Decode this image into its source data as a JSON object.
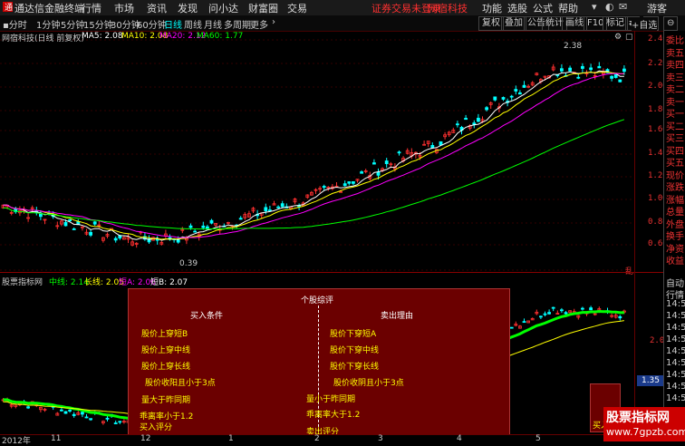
{
  "app": {
    "name": "通达信金融终端",
    "menu": [
      "行情",
      "市场",
      "资讯",
      "发现",
      "问小达",
      "财富圈",
      "交易"
    ],
    "notice": "证券交易未登录",
    "stock_name_top": "网宿科技",
    "right_menu": [
      "功能",
      "选股",
      "公式",
      "帮助"
    ],
    "guest": "游客"
  },
  "periods": [
    "分时",
    "1分钟",
    "5分钟",
    "15分钟",
    "30分钟",
    "60分钟",
    "日线",
    "周线",
    "月线",
    "多周期",
    "更多"
  ],
  "active_period": "日线",
  "toolbar_right": [
    "复权",
    "叠加",
    "公告",
    "统计",
    "画线",
    "F10",
    "标记"
  ],
  "main_chart": {
    "title": "网宿科技(日线 前复权)",
    "ma": [
      {
        "label": "MA5: 2.08",
        "color": "#ffffff"
      },
      {
        "label": "MA10: 2.08",
        "color": "#ffff00"
      },
      {
        "label": "MA20: 2.12",
        "color": "#ff00ff"
      },
      {
        "label": "MA60: 1.77",
        "color": "#00ff00"
      }
    ],
    "yticks": [
      "2.40",
      "2.20",
      "2.00",
      "1.80",
      "1.60",
      "1.40",
      "1.20",
      "1.00",
      "0.80",
      "0.60"
    ],
    "high_label": "2.38",
    "low_label": "0.39",
    "unit_mark": "乱"
  },
  "sub_chart": {
    "title": "股票指标网",
    "legend": [
      {
        "label": "中线: 2.14",
        "color": "#00ff00"
      },
      {
        "label": "长线: 2.05",
        "color": "#ffff00"
      },
      {
        "label": "短A: 2.06",
        "color": "#ff00ff"
      },
      {
        "label": "短B: 2.07",
        "color": "#ffffff"
      }
    ],
    "yticks": [
      "2.00",
      "1.35"
    ],
    "box": {
      "title": "个股综评",
      "buy_header": "买入条件",
      "sell_header": "卖出理由",
      "buy_items": [
        "股价上穿短B",
        "股价上穿中线",
        "股价上穿长线",
        "股价收阳且小于3点",
        "量大于昨同期",
        "乖离率小于1.2"
      ],
      "sell_items": [
        "股价下穿短A",
        "股价下穿中线",
        "股价下穿长线",
        "股价收阴且小于3点",
        "量小于昨同期",
        "乖离率大于1.2"
      ],
      "sell_score": "卖出评分",
      "buy_score_left": "买入评分",
      "buy_score_right": "买入评分"
    }
  },
  "x_axis": [
    "2012年",
    "11",
    "12",
    "1",
    "2",
    "3",
    "4",
    "5"
  ],
  "right_panel": {
    "top": [
      "委比",
      "卖五",
      "卖四",
      "卖三",
      "卖二",
      "卖一",
      "买一",
      "买二",
      "买三",
      "买四",
      "买五",
      "现价",
      "涨跌",
      "涨幅",
      "总量",
      "外盘",
      "换手",
      "净资",
      "收益"
    ],
    "bottom": [
      "自动",
      "行情",
      "14:50",
      "14:50",
      "14:50",
      "14:50",
      "14:50",
      "14:50",
      "14:50",
      "14:50",
      "14:50"
    ]
  },
  "watermark": {
    "line1": "股票指标网",
    "line2": "www.7gpzb.com"
  },
  "add_watch": "+自选",
  "colors": {
    "up": "#ff3030",
    "down": "#00ffff",
    "ma5": "#ffffff",
    "ma10": "#ffff00",
    "ma20": "#ff00ff",
    "ma60": "#00ff00",
    "box": "#6b0000"
  }
}
